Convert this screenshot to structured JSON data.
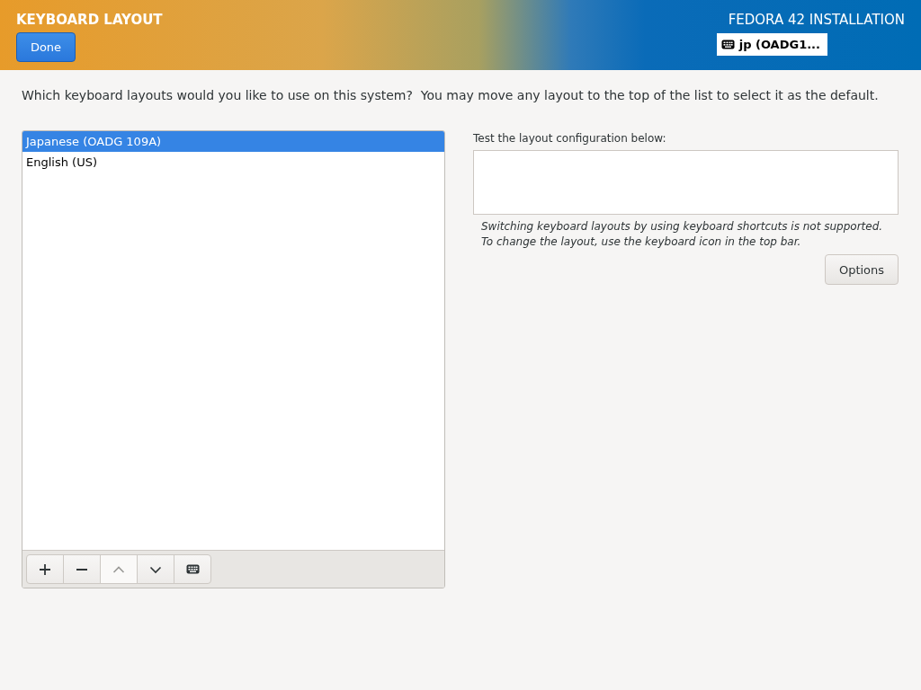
{
  "header": {
    "title": "KEYBOARD LAYOUT",
    "done_button": "Done",
    "product": "FEDORA 42 INSTALLATION",
    "keyboard_indicator": "jp (OADG1..."
  },
  "prompt": "Which keyboard layouts would you like to use on this system?  You may move any layout to the top of the list to select it as the default.",
  "layouts": [
    {
      "label": "Japanese (OADG 109A)",
      "selected": true
    },
    {
      "label": "English (US)",
      "selected": false
    }
  ],
  "toolbar": [
    {
      "kind": "add",
      "disabled": false
    },
    {
      "kind": "remove",
      "disabled": false
    },
    {
      "kind": "up",
      "disabled": true
    },
    {
      "kind": "down",
      "disabled": false
    },
    {
      "kind": "preview",
      "disabled": false
    }
  ],
  "test": {
    "label": "Test the layout configuration below:",
    "note": "Switching keyboard layouts by using keyboard shortcuts is not supported. To change the layout, use the keyboard icon in the top bar.",
    "options_button": "Options"
  }
}
